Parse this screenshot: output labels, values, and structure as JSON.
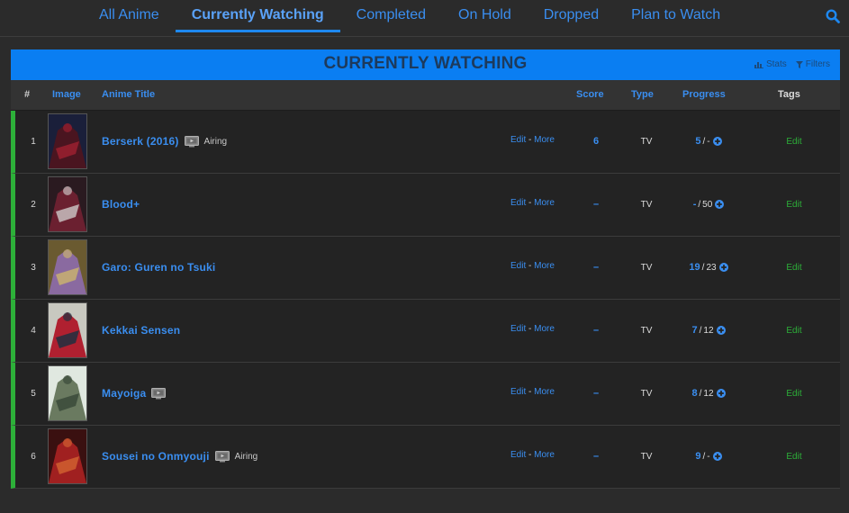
{
  "nav": {
    "tabs": [
      {
        "label": "All Anime",
        "active": false
      },
      {
        "label": "Currently Watching",
        "active": true
      },
      {
        "label": "Completed",
        "active": false
      },
      {
        "label": "On Hold",
        "active": false
      },
      {
        "label": "Dropped",
        "active": false
      },
      {
        "label": "Plan to Watch",
        "active": false
      }
    ],
    "search_icon": "search-icon"
  },
  "list": {
    "title": "CURRENTLY WATCHING",
    "stats_label": "Stats",
    "filters_label": "Filters",
    "columns": {
      "num": "#",
      "image": "Image",
      "title": "Anime Title",
      "score": "Score",
      "type": "Type",
      "progress": "Progress",
      "tags": "Tags"
    },
    "edit_label": "Edit",
    "more_label": "More",
    "dash_sep": "-",
    "progress_sep": "/",
    "tags_edit_label": "Edit",
    "rows": [
      {
        "num": "1",
        "title": "Berserk (2016)",
        "tv_icon": true,
        "status": "Airing",
        "score": "6",
        "type": "TV",
        "watched": "5",
        "total": "-",
        "cover": [
          "#1a1f3a",
          "#4a1520",
          "#9b2030"
        ]
      },
      {
        "num": "2",
        "title": "Blood+",
        "tv_icon": false,
        "status": "",
        "score": "–",
        "type": "TV",
        "watched": "-",
        "total": "50",
        "cover": [
          "#2a1a20",
          "#6b2030",
          "#c8c0c0"
        ]
      },
      {
        "num": "3",
        "title": "Garo: Guren no Tsuki",
        "tv_icon": false,
        "status": "",
        "score": "–",
        "type": "TV",
        "watched": "19",
        "total": "23",
        "cover": [
          "#6a5a30",
          "#8a6aa0",
          "#c8b070"
        ]
      },
      {
        "num": "4",
        "title": "Kekkai Sensen",
        "tv_icon": false,
        "status": "",
        "score": "–",
        "type": "TV",
        "watched": "7",
        "total": "12",
        "cover": [
          "#c8c8c0",
          "#b02030",
          "#203040"
        ]
      },
      {
        "num": "5",
        "title": "Mayoiga",
        "tv_icon": true,
        "status": "",
        "score": "–",
        "type": "TV",
        "watched": "8",
        "total": "12",
        "cover": [
          "#e0e8e0",
          "#6a7a60",
          "#3a4a3a"
        ]
      },
      {
        "num": "6",
        "title": "Sousei no Onmyouji",
        "tv_icon": true,
        "status": "Airing",
        "score": "–",
        "type": "TV",
        "watched": "9",
        "total": "-",
        "cover": [
          "#3a1010",
          "#a02020",
          "#d06030"
        ]
      }
    ]
  },
  "colors": {
    "accent": "#3a8ef0",
    "header_bar": "#0a7ef2",
    "watching_border": "#2db039",
    "row_bg": "#232323",
    "page_bg": "#2b2b2b"
  }
}
